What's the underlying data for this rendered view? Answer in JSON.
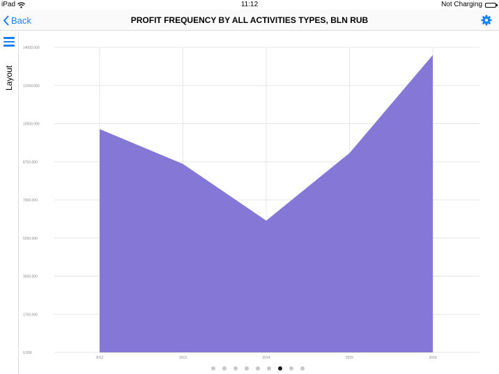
{
  "status_bar": {
    "device": "iPad",
    "time": "11:12",
    "battery_status": "Not Charging",
    "wifi_icon": "wifi-icon",
    "battery_icon": "battery-icon"
  },
  "nav": {
    "back_label": "Back",
    "title": "PROFIT FREQUENCY BY ALL ACTIVITIES TYPES, BLN RUB",
    "settings_icon": "gear-icon",
    "accent_color": "#147efb"
  },
  "sidebar": {
    "menu_icon": "hamburger-menu-icon",
    "layout_label": "Layout"
  },
  "chart_data": {
    "type": "area",
    "x": [
      "2012",
      "2013",
      "2014",
      "2015",
      "2016"
    ],
    "series": [
      {
        "values": [
          10250,
          8650,
          6050,
          9150,
          13650
        ],
        "color": "#8477d6"
      }
    ],
    "yticks": [
      "0.000",
      "1750.000",
      "3500.000",
      "5250.000",
      "7000.000",
      "8750.000",
      "10500.000",
      "12250.000",
      "14000.000"
    ],
    "ylim": [
      0,
      14000
    ],
    "grid": true
  },
  "pager": {
    "count": 9,
    "active_index": 6
  }
}
